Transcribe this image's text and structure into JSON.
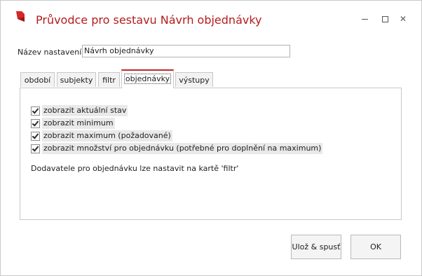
{
  "window": {
    "title": "Průvodce pro sestavu Návrh objednávky",
    "accent_color": "#b51c1c",
    "icons": {
      "app": "app-logo-icon",
      "minimize": "minimize-icon",
      "maximize": "maximize-icon",
      "close": "close-icon"
    }
  },
  "settings": {
    "name_label": "Název nastavení:",
    "name_value": "Návrh objednávky"
  },
  "tabs": [
    {
      "label": "období",
      "active": false
    },
    {
      "label": "subjekty",
      "active": false
    },
    {
      "label": "filtr",
      "active": false
    },
    {
      "label": "objednávky",
      "active": true
    },
    {
      "label": "výstupy",
      "active": false
    }
  ],
  "options": [
    {
      "label": "zobrazit aktuální stav",
      "checked": true
    },
    {
      "label": "zobrazit minimum",
      "checked": true
    },
    {
      "label": "zobrazit maximum (požadované)",
      "checked": true
    },
    {
      "label": "zobrazit množství pro objednávku (potřebné pro doplnění na maximum)",
      "checked": true
    }
  ],
  "note": "Dodavatele pro objednávku lze nastavit na kartě 'filtr'",
  "buttons": {
    "run_label": "Ulož & spusť",
    "ok_label": "OK"
  }
}
